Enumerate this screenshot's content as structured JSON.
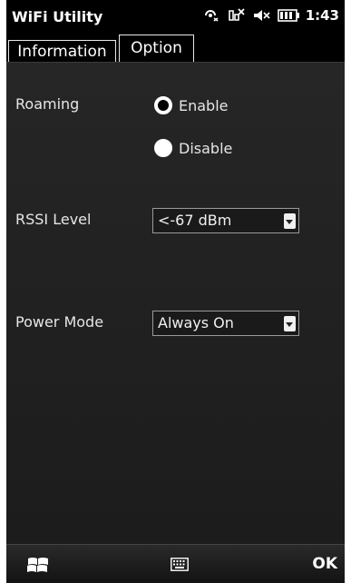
{
  "app": {
    "title": "WiFi Utility"
  },
  "status_bar": {
    "time": "1:43",
    "icons": [
      "connectivity-icon",
      "signal-off-icon",
      "speaker-muted-icon",
      "battery-icon"
    ]
  },
  "tabs": [
    {
      "label": "Information",
      "selected": false
    },
    {
      "label": "Option",
      "selected": true
    }
  ],
  "options": {
    "roaming": {
      "label": "Roaming",
      "choices": [
        {
          "label": "Enable",
          "selected": true
        },
        {
          "label": "Disable",
          "selected": false
        }
      ]
    },
    "rssi": {
      "label": "RSSI Level",
      "value": "<-67 dBm"
    },
    "power_mode": {
      "label": "Power Mode",
      "value": "Always On"
    }
  },
  "bottom_bar": {
    "ok_label": "OK",
    "start_icon": "windows-start-icon",
    "keyboard_icon": "keyboard-icon"
  },
  "colors": {
    "background": "#000000",
    "panel": "#222222",
    "text": "#e6e6e6"
  }
}
